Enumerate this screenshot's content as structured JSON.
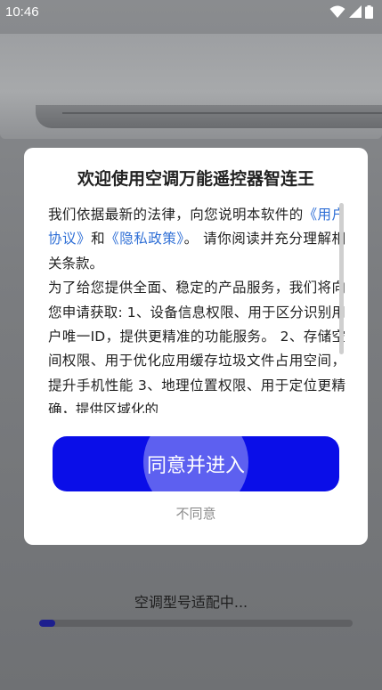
{
  "status_bar": {
    "time": "10:46",
    "icons": [
      "wifi-icon",
      "cellular-signal-icon",
      "battery-icon"
    ]
  },
  "dialog": {
    "title": "欢迎使用空调万能遥控器智连王",
    "body": {
      "intro_before": "我们依据最新的法律，向您说明本软件的",
      "link_user_agreement": "《用户协议》",
      "and": "和",
      "link_privacy_policy": "《隐私政策》",
      "intro_after": "。 请你阅读并充分理解相关条款。",
      "permissions": "为了给您提供全面、稳定的产品服务，我们将向您申请获取: 1、设备信息权限、用于区分识别用户唯一ID，提供更精准的功能服务。 2、存储空间权限、用于优化应用缓存垃圾文件占用空间，提升手机性能 3、地理位置权限、用于定位更精确，提供区域化的"
    },
    "agree_button": "同意并进入",
    "decline_link": "不同意"
  },
  "loading": {
    "text": "空调型号适配中...",
    "progress": 0.05
  },
  "colors": {
    "accent": "#0a0ee8",
    "link": "#2f6fd6",
    "decline_text": "#8c8c8c",
    "progress_fill": "#1d1f8e"
  }
}
